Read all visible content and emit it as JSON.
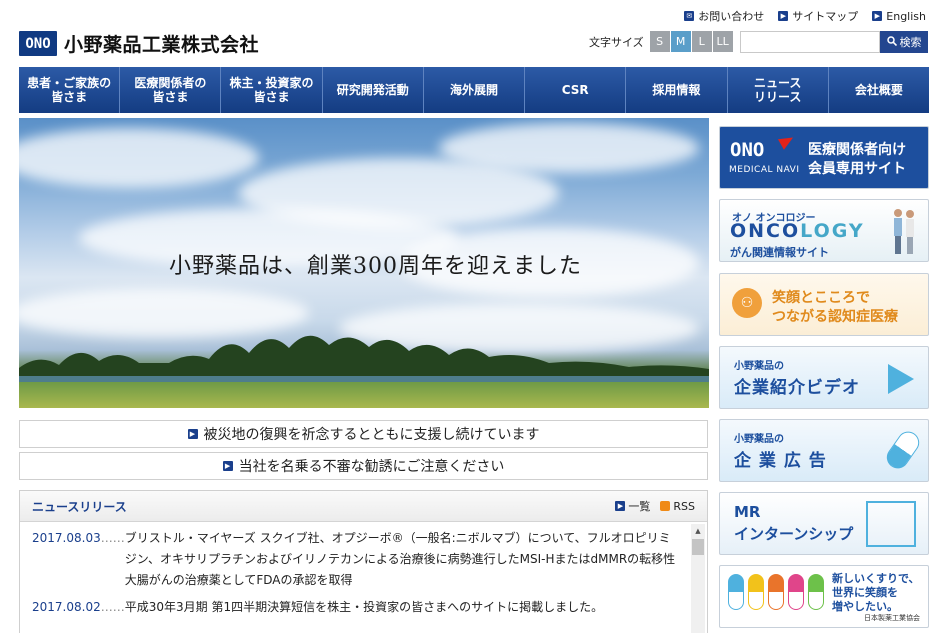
{
  "header": {
    "logo_mark": "ONO",
    "company_name": "小野薬品工業株式会社",
    "top_links": [
      "お問い合わせ",
      "サイトマップ",
      "English"
    ],
    "font_size_label": "文字サイズ",
    "font_sizes": [
      "S",
      "M",
      "L",
      "LL"
    ],
    "search_placeholder": "",
    "search_button": "検索"
  },
  "nav": {
    "items": [
      "患者・ご家族の\n皆さま",
      "医療関係者の\n皆さま",
      "株主・投資家の\n皆さま",
      "研究開発活動",
      "海外展開",
      "CSR",
      "採用情報",
      "ニュース\nリリース",
      "会社概要"
    ]
  },
  "hero": {
    "headline": "小野薬品は、創業300周年を迎えました"
  },
  "notices": [
    "被災地の復興を祈念するとともに支援し続けています",
    "当社を名乗る不審な勧誘にご注意ください"
  ],
  "news": {
    "title": "ニュースリリース",
    "list_link": "一覧",
    "rss_link": "RSS",
    "items": [
      {
        "date": "2017.08.03",
        "dots": "……",
        "text": "ブリストル・マイヤーズ スクイブ社、オプジーボ®（一般名:ニボルマブ）について、フルオロピリミジン、オキサリプラチンおよびイリノテカンによる治療後に病勢進行したMSI-HまたはdMMRの転移性大腸がんの治療薬としてFDAの承認を取得"
      },
      {
        "date": "2017.08.02",
        "dots": "……",
        "text": "平成30年3月期 第1四半期決算短信を株主・投資家の皆さまへのサイトに掲載しました。"
      }
    ]
  },
  "banners": {
    "medical_navi": {
      "logo": "ONO",
      "sub": "MEDICAL NAVI",
      "line1": "医療関係者向け",
      "line2": "会員専用サイト"
    },
    "oncology": {
      "sub": "オノ オンコロジー",
      "main_a": "ONCO",
      "main_b": "LOGY",
      "desc": "がん関連情報サイト"
    },
    "dementia": {
      "line1": "笑顔とこころで",
      "line2": "つながる認知症医療"
    },
    "video": {
      "sub": "小野薬品の",
      "main": "企業紹介ビデオ"
    },
    "ad": {
      "sub": "小野薬品の",
      "main": "企 業 広 告"
    },
    "internship": {
      "line1": "MR",
      "line2": "インターンシップ"
    },
    "jpma": {
      "text": "新しいくすりで、\n世界に笑顔を\n増やしたい。",
      "assoc": "日本製薬工業協会",
      "pill_colors": [
        "#4fb1de",
        "#f2c21b",
        "#e9742b",
        "#e0458a",
        "#6dc14a"
      ]
    }
  }
}
